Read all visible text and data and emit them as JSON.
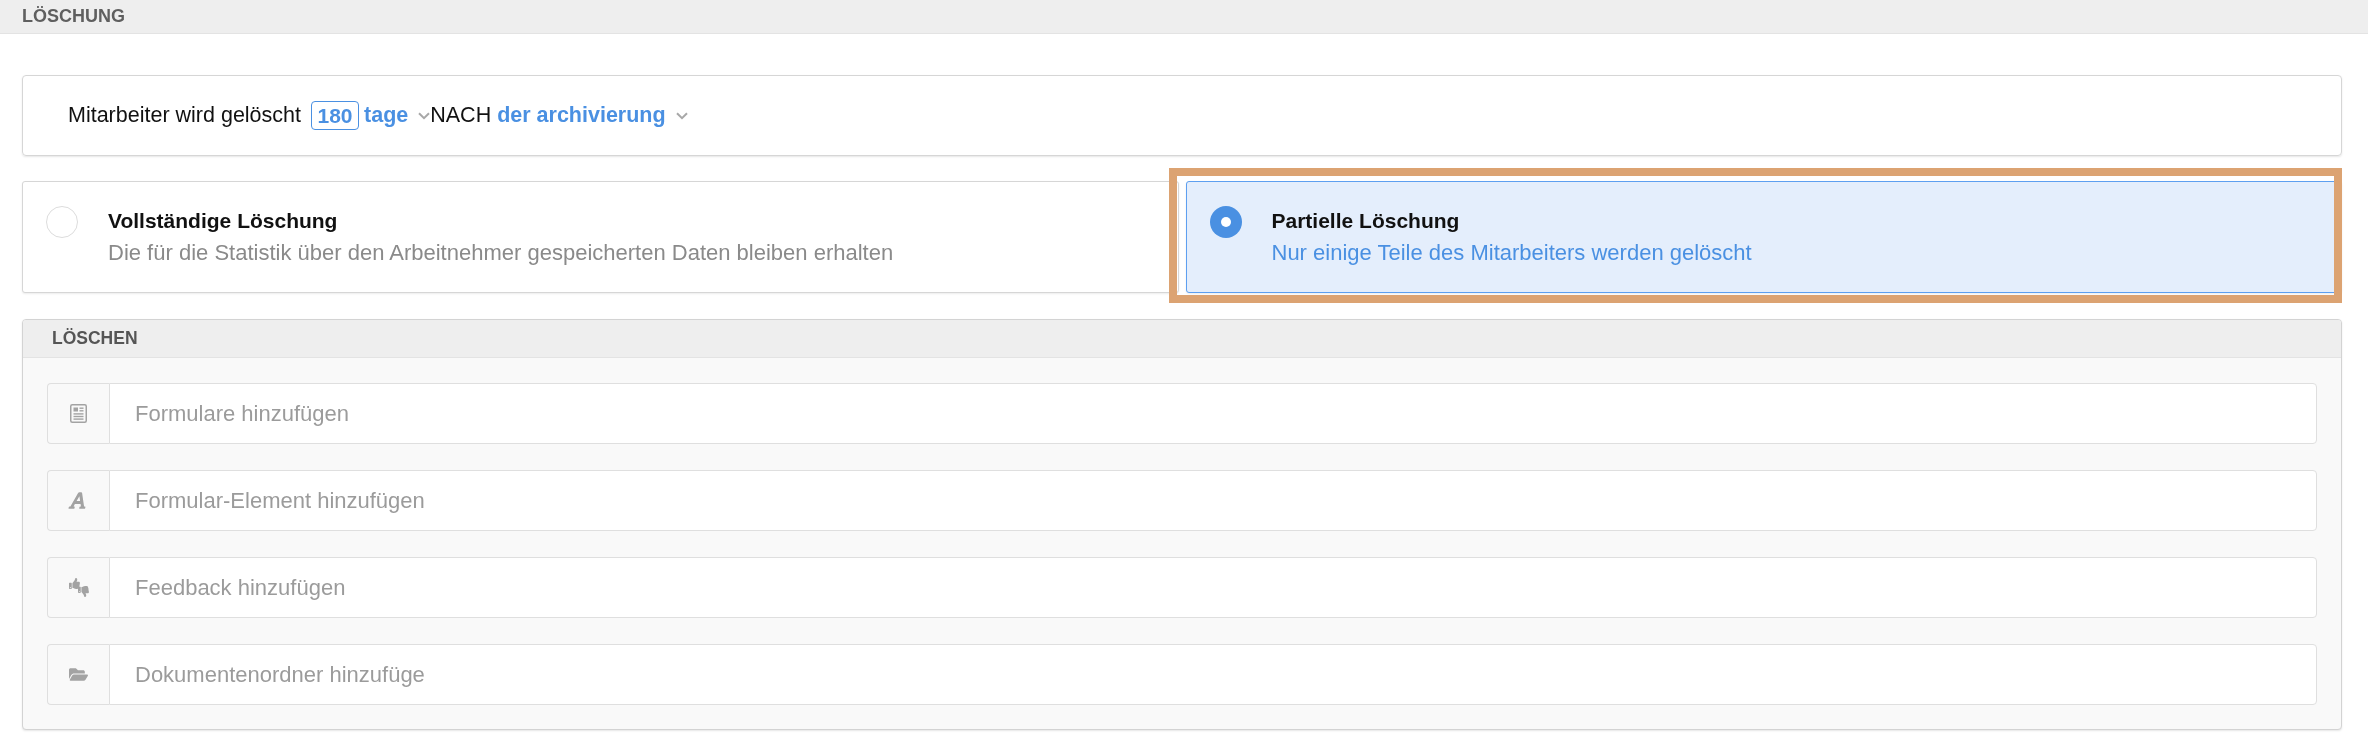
{
  "section_title": "LÖSCHUNG",
  "retention": {
    "label": "Mitarbeiter wird gelöscht",
    "days": "180",
    "unit": "tage",
    "connector": "NACH",
    "reference": "der archivierung"
  },
  "options": [
    {
      "title": "Vollständige Löschung",
      "description": "Die für die Statistik über den Arbeitnehmer gespeicherten Daten bleiben erhalten",
      "selected": false,
      "highlighted": false
    },
    {
      "title": "Partielle Löschung",
      "description": "Nur einige Teile des Mitarbeiters werden gelöscht",
      "selected": true,
      "highlighted": true
    }
  ],
  "delete_panel": {
    "title": "LÖSCHEN",
    "fields": [
      {
        "kind": "forms",
        "placeholder": "Formulare hinzufügen"
      },
      {
        "kind": "element",
        "placeholder": "Formular-Element hinzufügen"
      },
      {
        "kind": "feedback",
        "placeholder": "Feedback hinzufügen"
      },
      {
        "kind": "folder",
        "placeholder": "Dokumentenordner hinzufüge"
      }
    ]
  }
}
